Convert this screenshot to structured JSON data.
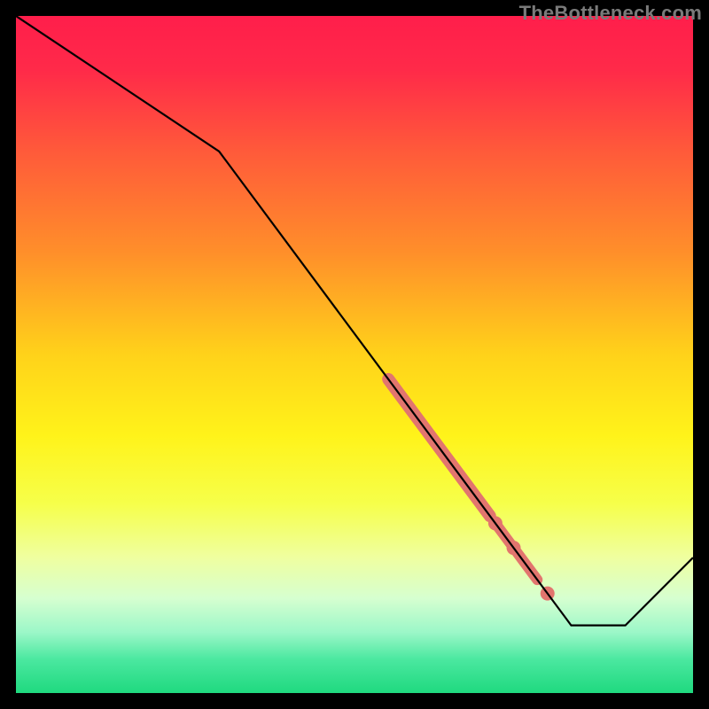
{
  "watermark": "TheBottleneck.com",
  "chart_data": {
    "type": "line",
    "xlim": [
      0,
      100
    ],
    "ylim": [
      0,
      100
    ],
    "title": "",
    "xlabel": "",
    "ylabel": "",
    "background_gradient_stops": [
      {
        "pos": 0.0,
        "color": "#ff1e4b"
      },
      {
        "pos": 0.08,
        "color": "#ff2a49"
      },
      {
        "pos": 0.2,
        "color": "#ff5a3a"
      },
      {
        "pos": 0.35,
        "color": "#ff8f2a"
      },
      {
        "pos": 0.5,
        "color": "#ffd21a"
      },
      {
        "pos": 0.62,
        "color": "#fff31a"
      },
      {
        "pos": 0.72,
        "color": "#f6ff4a"
      },
      {
        "pos": 0.8,
        "color": "#efffa0"
      },
      {
        "pos": 0.86,
        "color": "#d6ffd0"
      },
      {
        "pos": 0.91,
        "color": "#9cf7c8"
      },
      {
        "pos": 0.95,
        "color": "#4be8a0"
      },
      {
        "pos": 1.0,
        "color": "#1fd97f"
      }
    ],
    "curve": {
      "x": [
        0,
        30,
        82,
        90,
        100
      ],
      "y": [
        100,
        80,
        10,
        10,
        20
      ]
    },
    "highlight_segments": [
      {
        "x_start": 55,
        "x_end": 70,
        "width": 7
      },
      {
        "x_start": 71,
        "x_end": 73,
        "width": 6
      },
      {
        "x_start": 74,
        "x_end": 77,
        "width": 6
      }
    ],
    "highlight_dots": [
      {
        "x": 70.8,
        "r": 4
      },
      {
        "x": 73.5,
        "r": 4
      },
      {
        "x": 78.5,
        "r": 4
      }
    ],
    "highlight_color": "#e2756e"
  }
}
